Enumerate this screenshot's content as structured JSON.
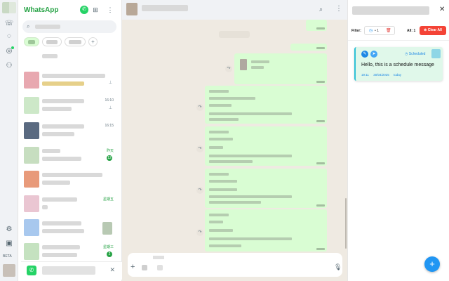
{
  "app": {
    "brand": "WhatsApp",
    "beta_label": "BETA"
  },
  "list": {
    "rows": [
      {
        "time": "",
        "badge": "",
        "pin": false
      },
      {
        "time": "",
        "badge": "",
        "pin": true
      },
      {
        "time": "16:10",
        "badge": "",
        "pin": true
      },
      {
        "time": "16:15",
        "badge": "",
        "pin": false
      },
      {
        "time": "昨天",
        "badge": "12",
        "pin": false
      },
      {
        "time": "",
        "badge": "",
        "pin": false
      },
      {
        "time": "星期五",
        "badge": "",
        "pin": false
      },
      {
        "time": "",
        "badge": "",
        "pin": false
      },
      {
        "time": "星期三",
        "badge": "2",
        "pin": false
      }
    ]
  },
  "panel": {
    "filter_label": "Filter:",
    "filter_count": "• 1",
    "all_label": "All: 1",
    "clear_all_label": "Clear All",
    "card": {
      "status": "Scheduled",
      "message": "Hello, this is a schedule message",
      "time": "19:11",
      "date": "30/04/2025",
      "day": "today"
    }
  },
  "icons": {
    "call": "call-icon",
    "status": "status-icon",
    "channels": "channels-icon",
    "communities": "communities-icon",
    "settings": "settings-icon",
    "search": "search-icon",
    "menu": "menu-icon",
    "close": "close-icon",
    "clock": "clock-icon",
    "trash": "trash-icon",
    "plus": "plus-icon",
    "mic": "mic-icon"
  },
  "colors": {
    "brand_green": "#25a244",
    "bubble_out": "#d9fdd3",
    "danger": "#f44336",
    "accent_blue": "#2196f3"
  }
}
